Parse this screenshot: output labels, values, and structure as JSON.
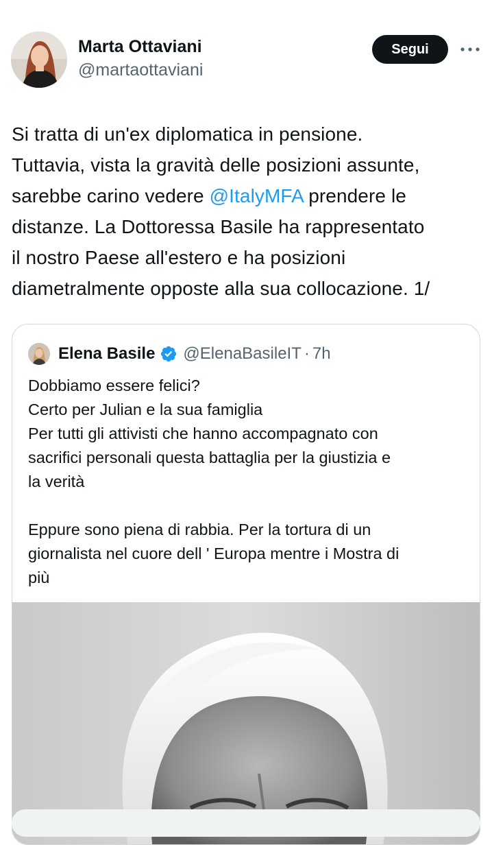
{
  "post": {
    "author_name": "Marta Ottaviani",
    "author_handle": "@martaottaviani",
    "follow_label": "Segui",
    "more_label": "More options",
    "text_segments": [
      {
        "text": "Si tratta di un'ex diplomatica in pensione."
      },
      {
        "text": "Tuttavia, vista la gravità delle posizioni assunte,"
      },
      {
        "text": "sarebbe carino vedere ",
        "mention": "@ItalyMFA",
        "after": " prendere le"
      },
      {
        "text": "distanze. La Dottoressa Basile ha rappresentato"
      },
      {
        "text": "il nostro Paese all'estero e ha posizioni"
      },
      {
        "text": "diametralmente opposte alla sua collocazione. 1/"
      }
    ]
  },
  "quoted": {
    "author_name": "Elena Basile",
    "verified": true,
    "handle": "@ElenaBasileIT",
    "separator": "·",
    "time": "7h",
    "lines": [
      "Dobbiamo essere felici?",
      "Certo per Julian e la sua famiglia",
      "Per tutti gli attivisti che hanno accompagnato con",
      "sacrifici personali questa battaglia per la giustizia e",
      "la verità",
      "",
      "Eppure sono piena di rabbia. Per la tortura di un",
      "giornalista nel cuore dell ' Europa mentre i Mostra di",
      "più"
    ],
    "media": {
      "kind": "black-and-white portrait photo"
    }
  },
  "colors": {
    "text": "#0f1419",
    "secondary": "#536471",
    "link": "#1d9bf0",
    "border": "#cfd9de",
    "button_bg": "#0f1419",
    "verified_badge": "#1d9bf0"
  },
  "icons": {
    "more": "more-horizontal-icon",
    "verified": "verified-badge-icon"
  }
}
